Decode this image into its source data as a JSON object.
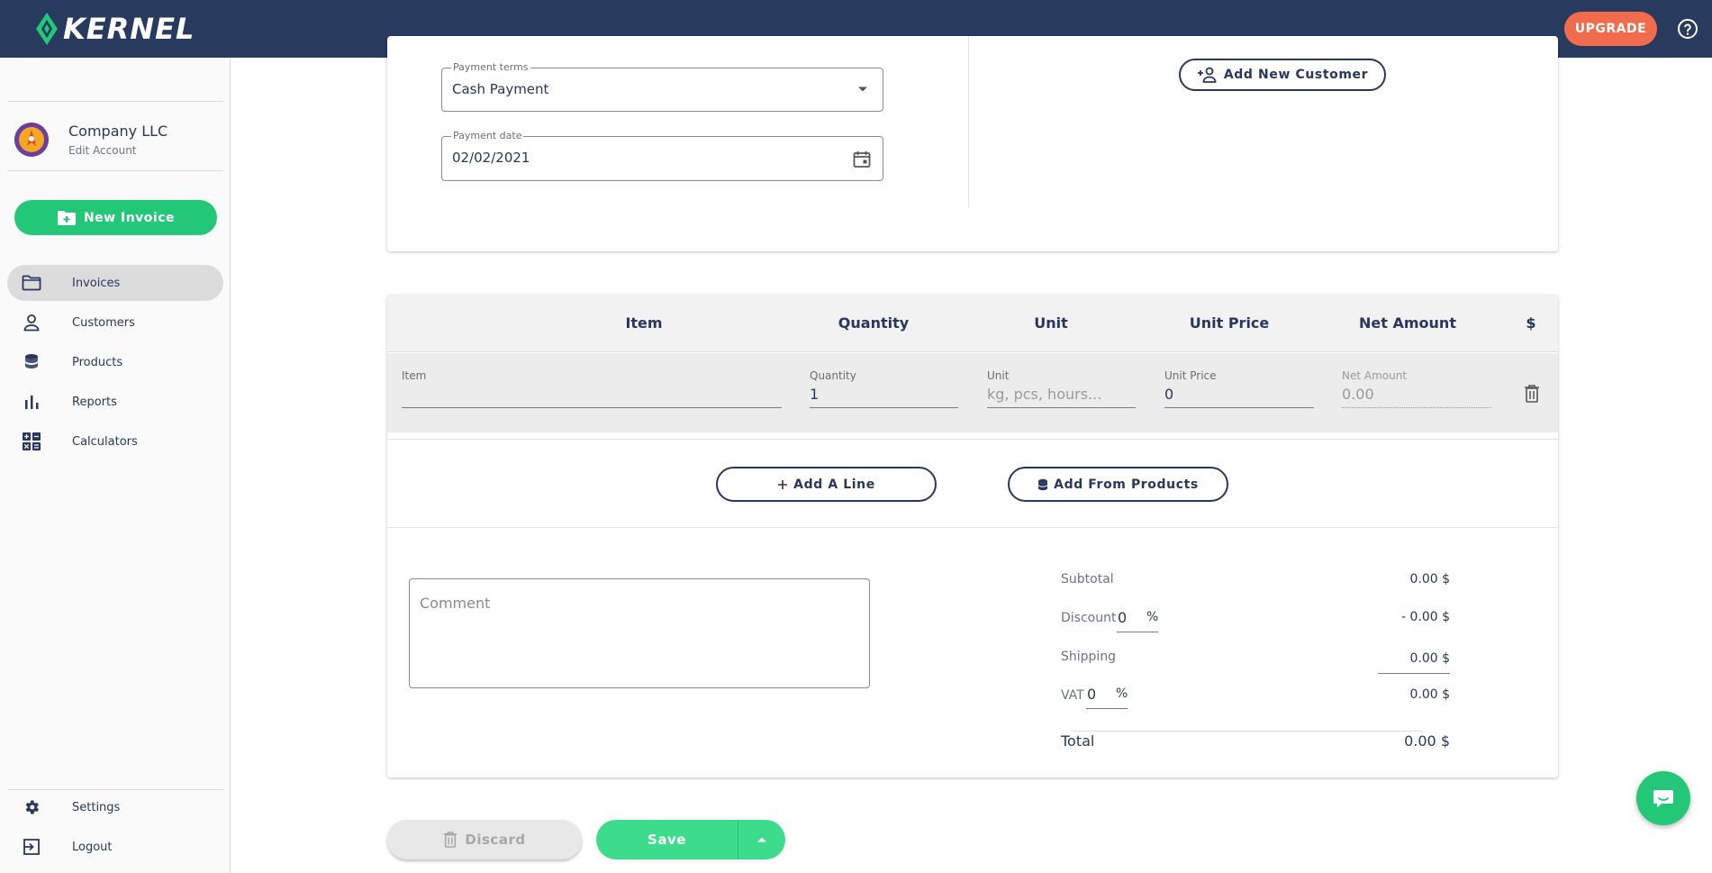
{
  "app": {
    "brand": "KERNEL",
    "upgrade_label": "UPGRADE",
    "colors": {
      "topbar": "#293a5f",
      "accent_green": "#22c877",
      "upgrade": "#f26b4c",
      "text": "#27375f"
    }
  },
  "sidebar": {
    "account": {
      "name": "Company LLC",
      "edit_label": "Edit Account"
    },
    "new_invoice_label": "New Invoice",
    "items": [
      {
        "label": "Invoices",
        "icon": "folder-icon",
        "active": true
      },
      {
        "label": "Customers",
        "icon": "person-icon"
      },
      {
        "label": "Products",
        "icon": "database-icon"
      },
      {
        "label": "Reports",
        "icon": "bar-chart-icon"
      },
      {
        "label": "Calculators",
        "icon": "calculator-icon"
      }
    ],
    "bottom": [
      {
        "label": "Settings",
        "icon": "gear-icon"
      },
      {
        "label": "Logout",
        "icon": "logout-icon"
      }
    ]
  },
  "payment": {
    "terms_label": "Payment terms",
    "terms_value": "Cash Payment",
    "date_label": "Payment date",
    "date_value": "02/02/2021",
    "add_customer_label": "Add New Customer"
  },
  "items_table": {
    "columns": [
      "Item",
      "Quantity",
      "Unit",
      "Unit Price",
      "Net Amount",
      "$"
    ],
    "row": {
      "item_label": "Item",
      "item_value": "",
      "quantity_label": "Quantity",
      "quantity_value": "1",
      "unit_label": "Unit",
      "unit_placeholder": "kg, pcs, hours...",
      "unit_price_label": "Unit Price",
      "unit_price_value": "0",
      "net_amount_label": "Net Amount",
      "net_amount_value": "0.00"
    },
    "add_line_label": "Add A Line",
    "add_products_label": "Add From Products"
  },
  "summary": {
    "comment_placeholder": "Comment",
    "subtotal_label": "Subtotal",
    "subtotal_value": "0.00 $",
    "discount_label": "Discount",
    "discount_input": "0",
    "discount_unit": "%",
    "discount_value": "- 0.00 $",
    "shipping_label": "Shipping",
    "shipping_value": "0.00 $",
    "vat_label": "VAT",
    "vat_input": "0",
    "vat_unit": "%",
    "vat_value": "0.00 $",
    "total_label": "Total",
    "total_value": "0.00 $"
  },
  "actions": {
    "discard_label": "Discard",
    "save_label": "Save"
  }
}
